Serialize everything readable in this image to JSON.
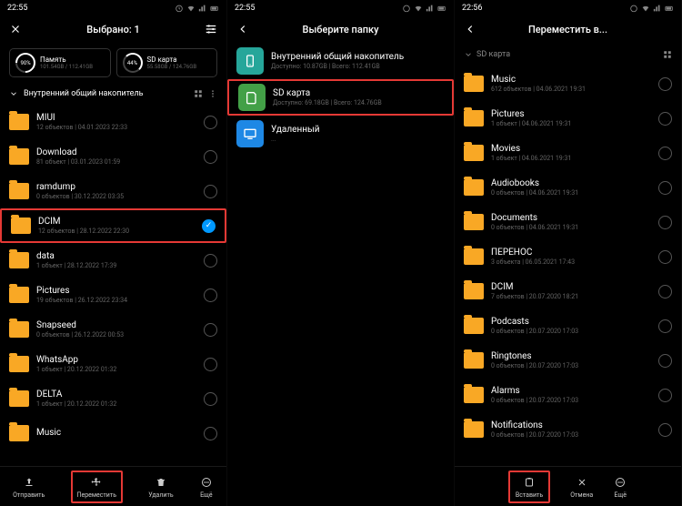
{
  "screen1": {
    "time": "22:55",
    "title": "Выбрано: 1",
    "storage1": {
      "name": "Память",
      "size": "101.54GB / 112.41GB",
      "percent": "90%"
    },
    "storage2": {
      "name": "SD карта",
      "size": "55.58GB / 124.76GB",
      "percent": "44%"
    },
    "path": "Внутренний общий накопитель",
    "files": [
      {
        "name": "MIUI",
        "meta": "12 объектов | 04.01.2023 22:33"
      },
      {
        "name": "Download",
        "meta": "81 объект | 03.01.2023 01:59"
      },
      {
        "name": "ramdump",
        "meta": "0 объектов | 30.12.2022 03:35"
      },
      {
        "name": "DCIM",
        "meta": "12 объектов | 28.12.2022 22:30"
      },
      {
        "name": "data",
        "meta": "1 объект | 28.12.2022 17:39"
      },
      {
        "name": "Pictures",
        "meta": "19 объектов | 26.12.2022 23:34"
      },
      {
        "name": "Snapseed",
        "meta": "0 объектов | 26.12.2022 00:53"
      },
      {
        "name": "WhatsApp",
        "meta": "1 объект | 20.12.2022 01:32"
      },
      {
        "name": "DELTA",
        "meta": "1 объект | 20.12.2022 01:32"
      },
      {
        "name": "Music",
        "meta": ""
      }
    ],
    "bottom": [
      "Отправить",
      "Переместить",
      "Удалить",
      "Ещё"
    ]
  },
  "screen2": {
    "time": "22:55",
    "title": "Выберите папку",
    "storages": [
      {
        "name": "Внутренний общий накопитель",
        "meta": "Доступно: 10.87GB | Всего: 112.41GB"
      },
      {
        "name": "SD карта",
        "meta": "Доступно: 69.18GB | Всего: 124.76GB"
      },
      {
        "name": "Удаленный",
        "meta": "..."
      }
    ]
  },
  "screen3": {
    "time": "22:56",
    "title": "Переместить в...",
    "path": "SD карта",
    "files": [
      {
        "name": "Music",
        "meta": "612 объектов | 04.06.2021 19:31"
      },
      {
        "name": "Pictures",
        "meta": "1 объект | 04.06.2021 19:31"
      },
      {
        "name": "Movies",
        "meta": "1 объект | 04.06.2021 19:31"
      },
      {
        "name": "Audiobooks",
        "meta": "0 объектов | 04.06.2021 19:31"
      },
      {
        "name": "Documents",
        "meta": "0 объектов | 04.06.2021 19:31"
      },
      {
        "name": "ПЕРЕНОС",
        "meta": "3 объекта | 06.05.2021 17:43"
      },
      {
        "name": "DCIM",
        "meta": "7 объектов | 20.07.2020 18:21"
      },
      {
        "name": "Podcasts",
        "meta": "0 объектов | 20.07.2020 17:03"
      },
      {
        "name": "Ringtones",
        "meta": "0 объектов | 20.07.2020 17:03"
      },
      {
        "name": "Alarms",
        "meta": "0 объектов | 20.07.2020 17:03"
      },
      {
        "name": "Notifications",
        "meta": "0 объектов | 20.07.2020 17:03"
      }
    ],
    "bottom": [
      "Вставить",
      "Отмена",
      "Ещё"
    ]
  }
}
